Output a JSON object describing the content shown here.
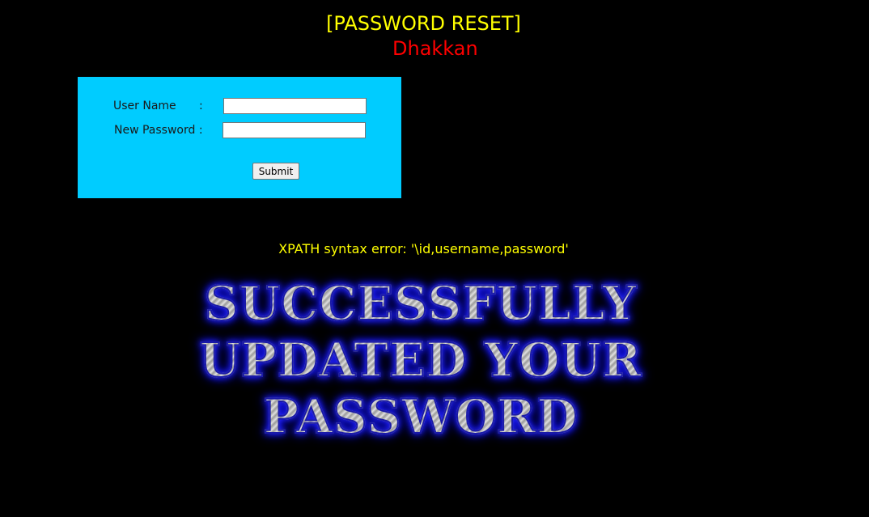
{
  "header": {
    "title": "[PASSWORD RESET]",
    "subtitle": "Dhakkan"
  },
  "form": {
    "username_label": "User Name",
    "username_colon": ":",
    "username_value": "",
    "password_label": "New Password :",
    "password_value": "",
    "submit_label": "Submit"
  },
  "message": {
    "error": "XPATH syntax error: '\\id,username,password'"
  },
  "banner": {
    "lines": [
      "SUCCESSFULLY",
      "UPDATED YOUR",
      "PASSWORD"
    ]
  },
  "colors": {
    "background": "#000000",
    "form_background": "#00ccff",
    "title": "#ffff00",
    "subtitle": "#ff0000",
    "error": "#ffff00"
  }
}
